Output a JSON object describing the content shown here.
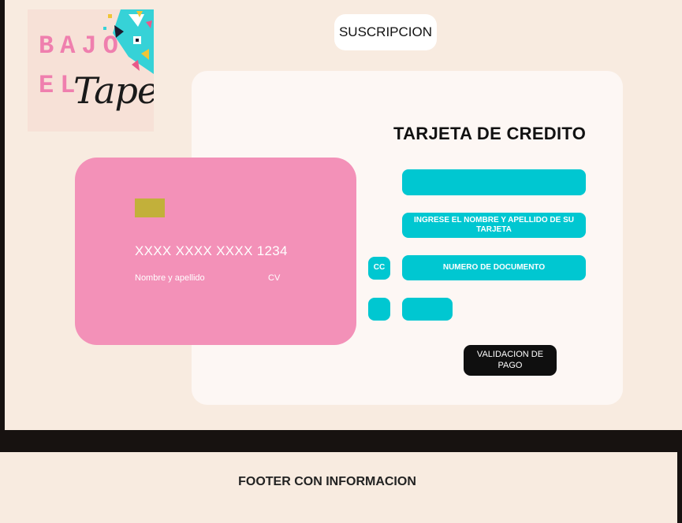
{
  "logo": {
    "line1": "BAJO",
    "line2": "EL",
    "script": "Tapete"
  },
  "header": {
    "subscription_label": "SUSCRIPCION"
  },
  "form": {
    "title": "TARJETA DE CREDITO",
    "card_field": "",
    "name_field": "INGRESE EL NOMBRE Y APELLIDO DE SU TARJETA",
    "doc_type": "CC",
    "doc_field": "NUMERO DE DOCUMENTO",
    "small_box": "",
    "cv_field": "",
    "submit_label": "VALIDACION DE PAGO"
  },
  "card": {
    "number": "XXXX XXXX XXXX 1234",
    "name_label": "Nombre y apellido",
    "cv_label": "CV"
  },
  "footer": {
    "text": "FOOTER CON INFORMACION"
  },
  "colors": {
    "page_bg": "#f8ebe0",
    "card_pink": "#f391b8",
    "field_teal": "#00c7d1",
    "chip": "#c2b03a",
    "dark": "#0f0f0f"
  }
}
